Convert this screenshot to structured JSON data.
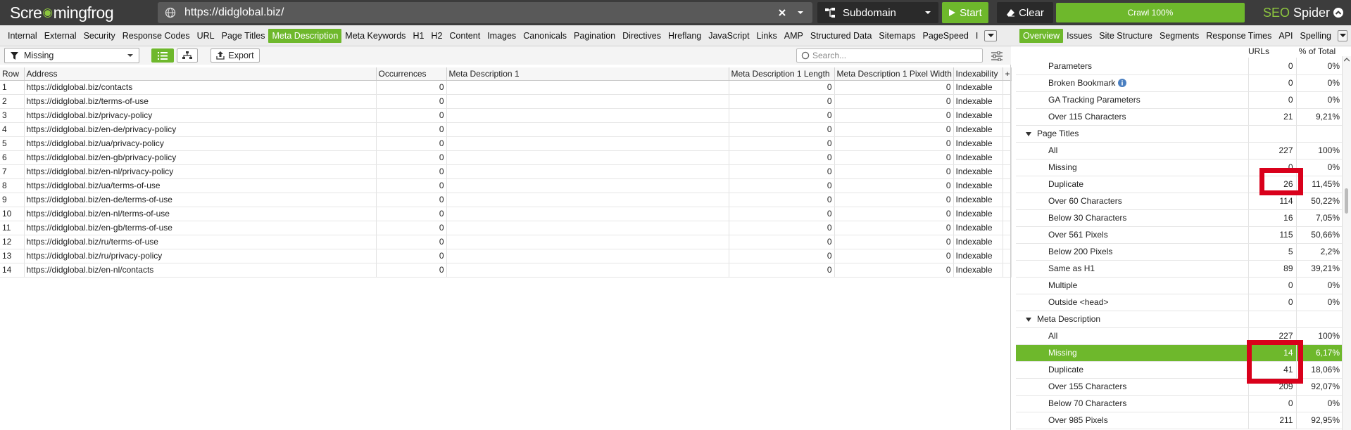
{
  "header": {
    "logo_prefix": "Scre",
    "logo_suffix": "mingfrog",
    "url": "https://didglobal.biz/",
    "mode": "Subdomain",
    "start_label": "Start",
    "clear_label": "Clear",
    "crawl_status": "Crawl 100%",
    "product_seo": "SEO",
    "product_spider": "Spider"
  },
  "left_tabs": [
    "Internal",
    "External",
    "Security",
    "Response Codes",
    "URL",
    "Page Titles",
    "Meta Description",
    "Meta Keywords",
    "H1",
    "H2",
    "Content",
    "Images",
    "Canonicals",
    "Pagination",
    "Directives",
    "Hreflang",
    "JavaScript",
    "Links",
    "AMP",
    "Structured Data",
    "Sitemaps",
    "PageSpeed",
    "I"
  ],
  "left_tabs_active": "Meta Description",
  "right_tabs": [
    "Overview",
    "Issues",
    "Site Structure",
    "Segments",
    "Response Times",
    "API",
    "Spelling"
  ],
  "right_tabs_active": "Overview",
  "filter": {
    "value": "Missing",
    "export_label": "Export",
    "search_placeholder": "Search..."
  },
  "table": {
    "columns": [
      "Row",
      "Address",
      "Occurrences",
      "Meta Description 1",
      "Meta Description 1 Length",
      "Meta Description 1 Pixel Width",
      "Indexability",
      "+"
    ],
    "rows": [
      [
        "1",
        "https://didglobal.biz/contacts",
        "0",
        "",
        "0",
        "0",
        "Indexable"
      ],
      [
        "2",
        "https://didglobal.biz/terms-of-use",
        "0",
        "",
        "0",
        "0",
        "Indexable"
      ],
      [
        "3",
        "https://didglobal.biz/privacy-policy",
        "0",
        "",
        "0",
        "0",
        "Indexable"
      ],
      [
        "4",
        "https://didglobal.biz/en-de/privacy-policy",
        "0",
        "",
        "0",
        "0",
        "Indexable"
      ],
      [
        "5",
        "https://didglobal.biz/ua/privacy-policy",
        "0",
        "",
        "0",
        "0",
        "Indexable"
      ],
      [
        "6",
        "https://didglobal.biz/en-gb/privacy-policy",
        "0",
        "",
        "0",
        "0",
        "Indexable"
      ],
      [
        "7",
        "https://didglobal.biz/en-nl/privacy-policy",
        "0",
        "",
        "0",
        "0",
        "Indexable"
      ],
      [
        "8",
        "https://didglobal.biz/ua/terms-of-use",
        "0",
        "",
        "0",
        "0",
        "Indexable"
      ],
      [
        "9",
        "https://didglobal.biz/en-de/terms-of-use",
        "0",
        "",
        "0",
        "0",
        "Indexable"
      ],
      [
        "10",
        "https://didglobal.biz/en-nl/terms-of-use",
        "0",
        "",
        "0",
        "0",
        "Indexable"
      ],
      [
        "11",
        "https://didglobal.biz/en-gb/terms-of-use",
        "0",
        "",
        "0",
        "0",
        "Indexable"
      ],
      [
        "12",
        "https://didglobal.biz/ru/terms-of-use",
        "0",
        "",
        "0",
        "0",
        "Indexable"
      ],
      [
        "13",
        "https://didglobal.biz/ru/privacy-policy",
        "0",
        "",
        "0",
        "0",
        "Indexable"
      ],
      [
        "14",
        "https://didglobal.biz/en-nl/contacts",
        "0",
        "",
        "0",
        "0",
        "Indexable"
      ]
    ]
  },
  "overview": {
    "col_urls": "URLs",
    "col_pct": "% of Total",
    "rows": [
      {
        "kind": "item",
        "name": "Parameters",
        "urls": "0",
        "pct": "0%"
      },
      {
        "kind": "item",
        "name": "Broken Bookmark",
        "urls": "0",
        "pct": "0%",
        "info": true
      },
      {
        "kind": "item",
        "name": "GA Tracking Parameters",
        "urls": "0",
        "pct": "0%"
      },
      {
        "kind": "item",
        "name": "Over 115 Characters",
        "urls": "21",
        "pct": "9,21%"
      },
      {
        "kind": "section",
        "name": "Page Titles"
      },
      {
        "kind": "item",
        "name": "All",
        "urls": "227",
        "pct": "100%"
      },
      {
        "kind": "item",
        "name": "Missing",
        "urls": "0",
        "pct": "0%"
      },
      {
        "kind": "item",
        "name": "Duplicate",
        "urls": "26",
        "pct": "11,45%"
      },
      {
        "kind": "item",
        "name": "Over 60 Characters",
        "urls": "114",
        "pct": "50,22%"
      },
      {
        "kind": "item",
        "name": "Below 30 Characters",
        "urls": "16",
        "pct": "7,05%"
      },
      {
        "kind": "item",
        "name": "Over 561 Pixels",
        "urls": "115",
        "pct": "50,66%"
      },
      {
        "kind": "item",
        "name": "Below 200 Pixels",
        "urls": "5",
        "pct": "2,2%"
      },
      {
        "kind": "item",
        "name": "Same as H1",
        "urls": "89",
        "pct": "39,21%"
      },
      {
        "kind": "item",
        "name": "Multiple",
        "urls": "0",
        "pct": "0%"
      },
      {
        "kind": "item",
        "name": "Outside <head>",
        "urls": "0",
        "pct": "0%"
      },
      {
        "kind": "section",
        "name": "Meta Description"
      },
      {
        "kind": "item",
        "name": "All",
        "urls": "227",
        "pct": "100%"
      },
      {
        "kind": "item",
        "name": "Missing",
        "urls": "14",
        "pct": "6,17%",
        "selected": true
      },
      {
        "kind": "item",
        "name": "Duplicate",
        "urls": "41",
        "pct": "18,06%"
      },
      {
        "kind": "item",
        "name": "Over 155 Characters",
        "urls": "209",
        "pct": "92,07%"
      },
      {
        "kind": "item",
        "name": "Below 70 Characters",
        "urls": "0",
        "pct": "0%"
      },
      {
        "kind": "item",
        "name": "Over 985 Pixels",
        "urls": "211",
        "pct": "92,95%"
      }
    ]
  },
  "colors": {
    "accent": "#6eb82c",
    "topbar": "#3c3c3c",
    "highlight": "#d9001b"
  },
  "icons": [
    "globe-icon",
    "clear-url-icon",
    "dropdown-icon",
    "structure-icon",
    "play-icon",
    "eraser-icon",
    "collapse-icon",
    "funnel-icon",
    "list-view-icon",
    "tree-view-icon",
    "export-icon",
    "search-icon",
    "filter-settings-icon",
    "info-icon"
  ]
}
